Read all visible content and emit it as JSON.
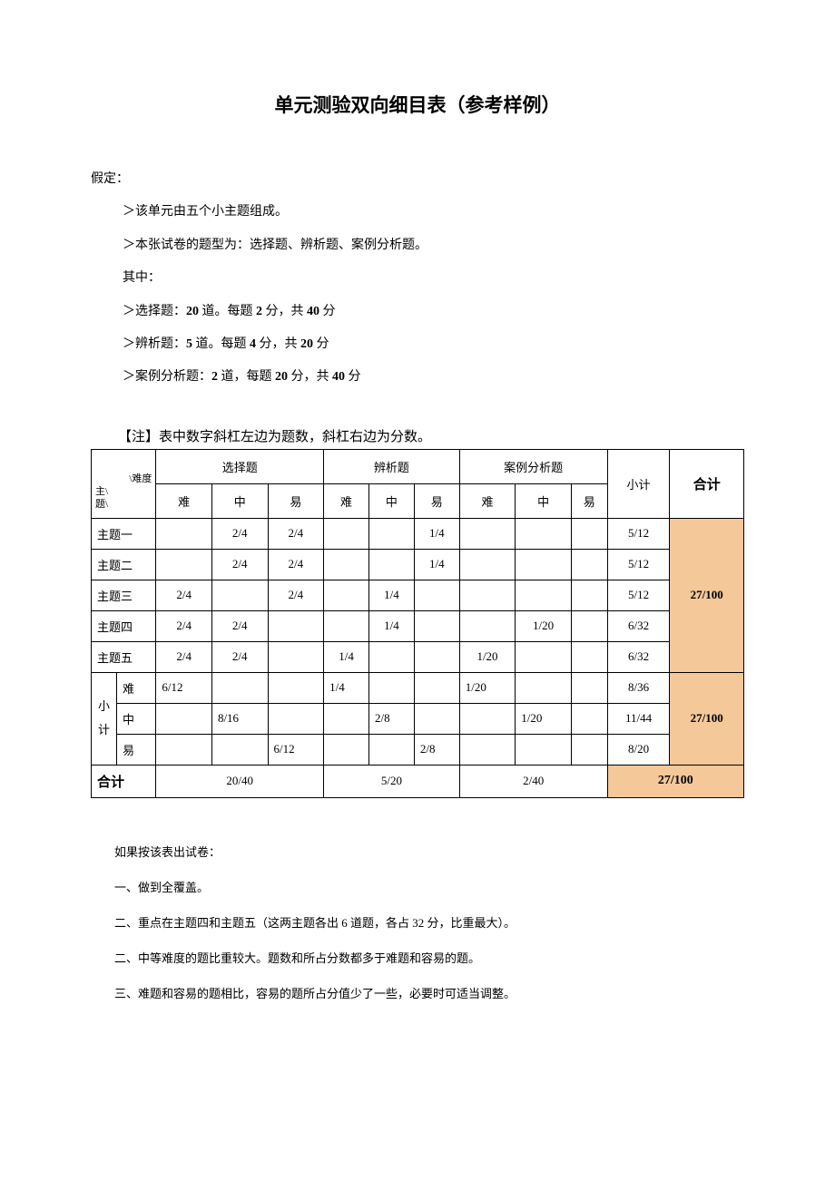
{
  "title": "单元测验双向细目表（参考样例）",
  "intro": {
    "assumption": "假定：",
    "a1": "＞该单元由五个小主题组成。",
    "a2": "＞本张试卷的题型为：选择题、辨析题、案例分析题。",
    "among": "其中：",
    "b1_pre": "＞选择题：",
    "b1_num": "20",
    "b1_mid": " 道。每题 ",
    "b1_per": "2",
    "b1_mid2": " 分，共 ",
    "b1_tot": "40",
    "b1_suf": " 分",
    "b2_pre": "＞辨析题：",
    "b2_num": "5",
    "b2_mid": " 道。每题 ",
    "b2_per": "4",
    "b2_mid2": " 分，共 ",
    "b2_tot": "20",
    "b2_suf": " 分",
    "b3_pre": "＞案例分析题：",
    "b3_num": "2",
    "b3_mid": " 道，每题 ",
    "b3_per": "20",
    "b3_mid2": " 分，共 ",
    "b3_tot": "40",
    "b3_suf": " 分"
  },
  "note_label": "【注】表中数字斜杠左边为题数，斜杠右边为分数。",
  "headers": {
    "choice": "选择题",
    "discern": "辨析题",
    "case": "案例分析题",
    "subtotal": "小计",
    "total": "合计",
    "hard": "难",
    "mid": "中",
    "easy": "易",
    "diag1": "\\难度",
    "diag2": "主\\",
    "diag3": "题\\"
  },
  "chart_data": {
    "type": "table",
    "rows": [
      {
        "topic": "主题一",
        "ch": "",
        "cm": "2/4",
        "ce": "2/4",
        "dh": "",
        "dm": "",
        "de": "1/4",
        "ah": "",
        "am": "",
        "ae": "",
        "sub": "5/12"
      },
      {
        "topic": "主题二",
        "ch": "",
        "cm": "2/4",
        "ce": "2/4",
        "dh": "",
        "dm": "",
        "de": "1/4",
        "ah": "",
        "am": "",
        "ae": "",
        "sub": "5/12"
      },
      {
        "topic": "主题三",
        "ch": "2/4",
        "cm": "",
        "ce": "2/4",
        "dh": "",
        "dm": "1/4",
        "de": "",
        "ah": "",
        "am": "",
        "ae": "",
        "sub": "5/12"
      },
      {
        "topic": "主题四",
        "ch": "2/4",
        "cm": "2/4",
        "ce": "",
        "dh": "",
        "dm": "1/4",
        "de": "",
        "ah": "",
        "am": "1/20",
        "ae": "",
        "sub": "6/32"
      },
      {
        "topic": "主题五",
        "ch": "2/4",
        "cm": "2/4",
        "ce": "",
        "dh": "1/4",
        "dm": "",
        "de": "",
        "ah": "1/20",
        "am": "",
        "ae": "",
        "sub": "6/32"
      }
    ],
    "topic_total": "27/100",
    "subtotal_label": "小计",
    "sub_rows": [
      {
        "level": "难",
        "ch": "6/12",
        "cm": "",
        "ce": "",
        "dh": "1/4",
        "dm": "",
        "de": "",
        "ah": "1/20",
        "am": "",
        "ae": "",
        "sub": "8/36"
      },
      {
        "level": "中",
        "ch": "",
        "cm": "8/16",
        "ce": "",
        "dh": "",
        "dm": "2/8",
        "de": "",
        "ah": "",
        "am": "1/20",
        "ae": "",
        "sub": "11/44"
      },
      {
        "level": "易",
        "ch": "",
        "cm": "",
        "ce": "6/12",
        "dh": "",
        "dm": "",
        "de": "2/8",
        "ah": "",
        "am": "",
        "ae": "",
        "sub": "8/20"
      }
    ],
    "sub_total": "27/100",
    "grand": {
      "label": "合计",
      "choice": "20/40",
      "discern": "5/20",
      "case": "2/40",
      "total": "27/100"
    }
  },
  "footer": {
    "p0": "如果按该表出试卷：",
    "p1": "一、做到全覆盖。",
    "p2": "二、重点在主题四和主题五（这两主题各出 6 道题，各占 32 分，比重最大）。",
    "p3": "二、中等难度的题比重较大。题数和所占分数都多于难题和容易的题。",
    "p4": "三、难题和容易的题相比，容易的题所占分值少了一些，必要时可适当调整。"
  }
}
